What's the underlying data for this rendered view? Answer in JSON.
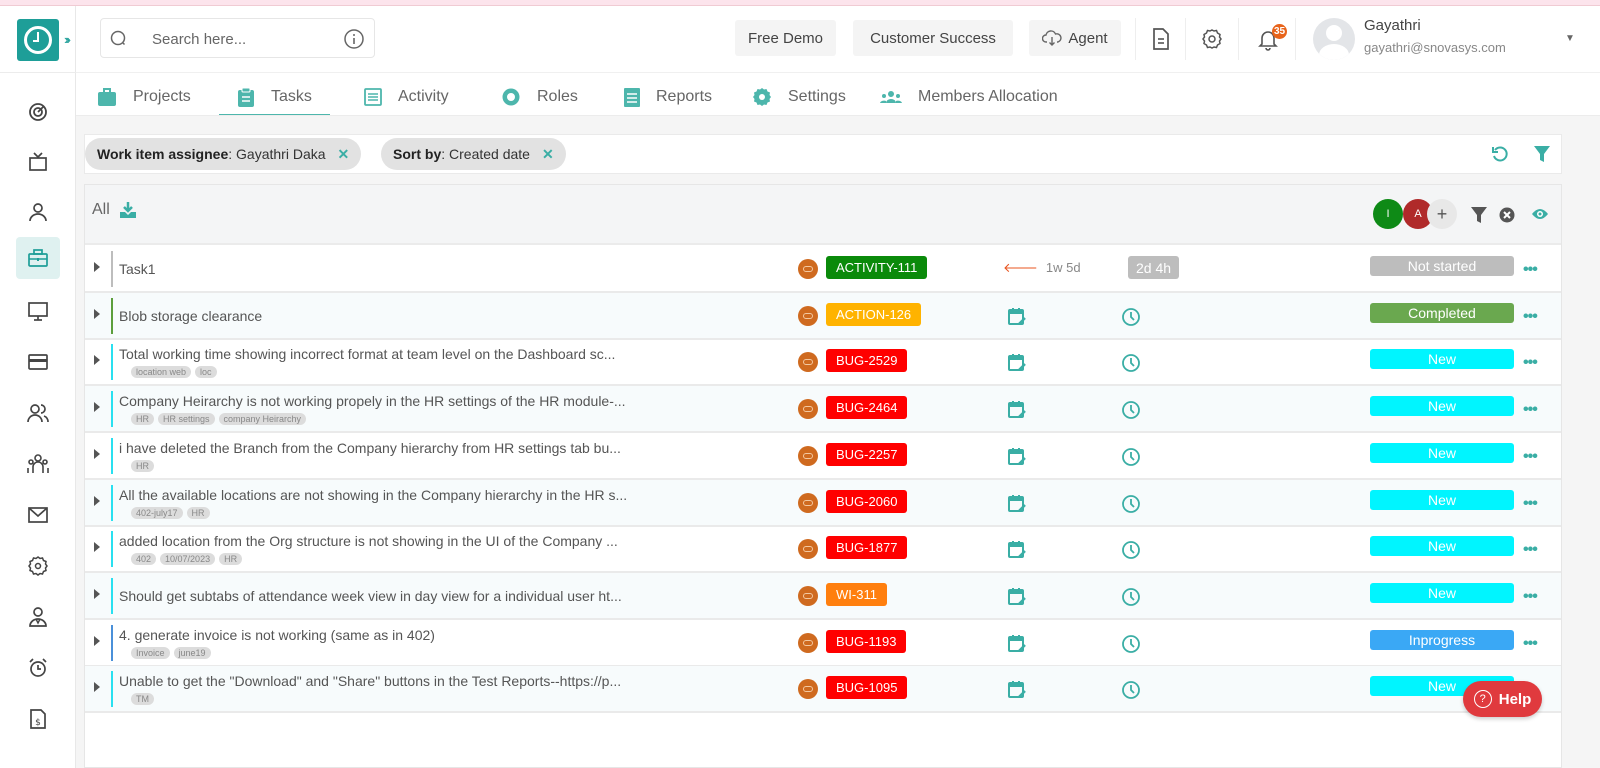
{
  "header": {
    "search_placeholder": "Search here...",
    "buttons": [
      "Free Demo",
      "Customer Success",
      "Agent"
    ],
    "notification_count": "35",
    "user": {
      "name": "Gayathri",
      "email": "gayathri@snovasys.com"
    }
  },
  "sidebar": {
    "items": [
      {
        "icon": "dashboard-icon"
      },
      {
        "icon": "tv-icon"
      },
      {
        "icon": "user-icon"
      },
      {
        "icon": "briefcase-icon",
        "active": true
      },
      {
        "icon": "monitor-icon"
      },
      {
        "icon": "credit-card-icon"
      },
      {
        "icon": "users-icon"
      },
      {
        "icon": "team-icon"
      },
      {
        "icon": "mail-icon"
      },
      {
        "icon": "settings-icon"
      },
      {
        "icon": "employee-icon"
      },
      {
        "icon": "alarm-icon"
      },
      {
        "icon": "invoice-icon"
      }
    ]
  },
  "tabs": [
    {
      "label": "Projects",
      "icon": "briefcase-icon"
    },
    {
      "label": "Tasks",
      "icon": "clipboard-icon",
      "active": true
    },
    {
      "label": "Activity",
      "icon": "list-icon"
    },
    {
      "label": "Roles",
      "icon": "badge-icon"
    },
    {
      "label": "Reports",
      "icon": "report-icon"
    },
    {
      "label": "Settings",
      "icon": "gear-icon"
    },
    {
      "label": "Members Allocation",
      "icon": "members-icon"
    }
  ],
  "filters": [
    {
      "key": "Work item assignee",
      "value": " : Gayathri Daka"
    },
    {
      "key": "Sort by",
      "value": " : Created date"
    }
  ],
  "list": {
    "label": "All",
    "avatars": [
      {
        "initial": "I",
        "color": "#0e8a16"
      },
      {
        "initial": "A",
        "color": "#b02a2a"
      }
    ],
    "rows": [
      {
        "title": "Task1",
        "tags": [],
        "bar_color": "#bdbdbd",
        "key": "ACTIVITY-111",
        "key_color": "#0a8a0a",
        "due": "1w 5d",
        "estimate": "2d 4h",
        "status": "Not started",
        "status_color": "#bdbdbd"
      },
      {
        "title": "Blob storage clearance",
        "tags": [],
        "bar_color": "#5c9e3c",
        "key": "ACTION-126",
        "key_color": "#ffb300",
        "status": "Completed",
        "status_color": "#6aa84f"
      },
      {
        "title": "Total working time showing incorrect format at team level on the Dashboard sc...",
        "tags": [
          "location web",
          "loc"
        ],
        "bar_color": "#29e0f0",
        "key": "BUG-2529",
        "key_color": "#ff0000",
        "status": "New",
        "status_color": "#00f5ff"
      },
      {
        "title": "Company Heirarchy is not working propely in the HR settings of the HR module-...",
        "tags": [
          "HR",
          "HR settings",
          "company Heirarchy"
        ],
        "bar_color": "#29e0f0",
        "key": "BUG-2464",
        "key_color": "#ff0000",
        "status": "New",
        "status_color": "#00f5ff"
      },
      {
        "title": "i have deleted the Branch from the Company hierarchy from HR settings tab bu...",
        "tags": [
          "HR"
        ],
        "bar_color": "#29e0f0",
        "key": "BUG-2257",
        "key_color": "#ff0000",
        "status": "New",
        "status_color": "#00f5ff"
      },
      {
        "title": "All the available locations are not showing in the Company hierarchy in the HR s...",
        "tags": [
          "402-july17",
          "HR"
        ],
        "bar_color": "#29e0f0",
        "key": "BUG-2060",
        "key_color": "#ff0000",
        "status": "New",
        "status_color": "#00f5ff"
      },
      {
        "title": "added location from the Org structure is not showing in the UI of the Company ...",
        "tags": [
          "402",
          "10/07/2023",
          "HR"
        ],
        "bar_color": "#29e0f0",
        "key": "BUG-1877",
        "key_color": "#ff0000",
        "status": "New",
        "status_color": "#00f5ff"
      },
      {
        "title": "Should get subtabs of attendance week view in day view for a individual user ht...",
        "tags": [],
        "bar_color": "#29e0f0",
        "key": "WI-311",
        "key_color": "#ff7f0e",
        "status": "New",
        "status_color": "#00f5ff"
      },
      {
        "title": "4. generate invoice is not working (same as in 402)",
        "tags": [
          "Invoice",
          "june19"
        ],
        "bar_color": "#4a90d9",
        "key": "BUG-1193",
        "key_color": "#ff0000",
        "status": "Inprogress",
        "status_color": "#3aa8f5"
      },
      {
        "title": "Unable to get the \"Download\" and \"Share\" buttons in the Test Reports--https://p...",
        "tags": [
          "TM"
        ],
        "bar_color": "#29e0f0",
        "key": "BUG-1095",
        "key_color": "#ff0000",
        "status": "New",
        "status_color": "#00f5ff"
      }
    ]
  },
  "help": {
    "label": "Help"
  }
}
